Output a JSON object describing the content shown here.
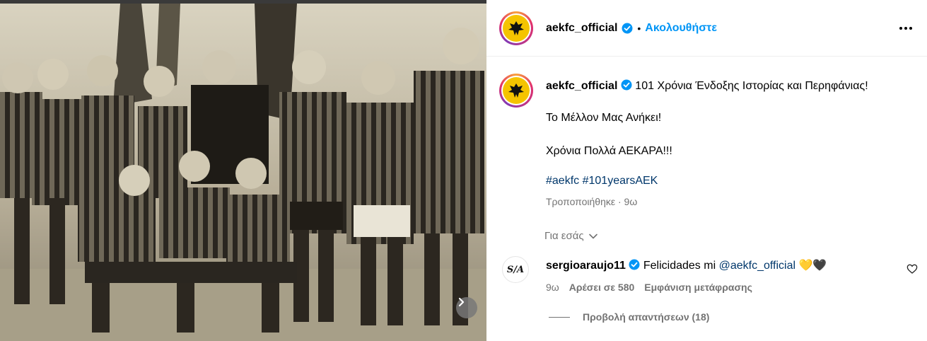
{
  "post": {
    "username": "aekfc_official",
    "follow_label": "Ακολουθήστε",
    "separator": "•"
  },
  "caption": {
    "username": "aekfc_official",
    "line1": "101 Χρόνια Ένδοξης Ιστορίας και Περηφάνιας!",
    "line2": "Το Μέλλον Μας Ανήκει!",
    "line3": "Χρόνια Πολλά ΑΕΚΑΡΑ!!!",
    "hashtags": [
      "#aekfc",
      "#101yearsAEK"
    ],
    "edited": "Τροποποιήθηκε · 9ω"
  },
  "for_you_label": "Για εσάς",
  "comment": {
    "username": "sergioaraujo11",
    "text": "Felicidades mi",
    "mention": "@aekfc_official",
    "emoji": "💛🖤",
    "time": "9ω",
    "likes": "Αρέσει σε 580",
    "translate": "Εμφάνιση μετάφρασης",
    "avatar_text": "S/A"
  },
  "replies_label": "Προβολή απαντήσεων (18)",
  "colors": {
    "follow": "#0095f6",
    "link": "#00376b",
    "muted": "#737373",
    "aek_yellow": "#f5c400"
  },
  "icons": [
    "verified-icon",
    "more-icon",
    "chevron-down-icon",
    "heart-icon",
    "next-arrow-icon",
    "aek-logo"
  ]
}
